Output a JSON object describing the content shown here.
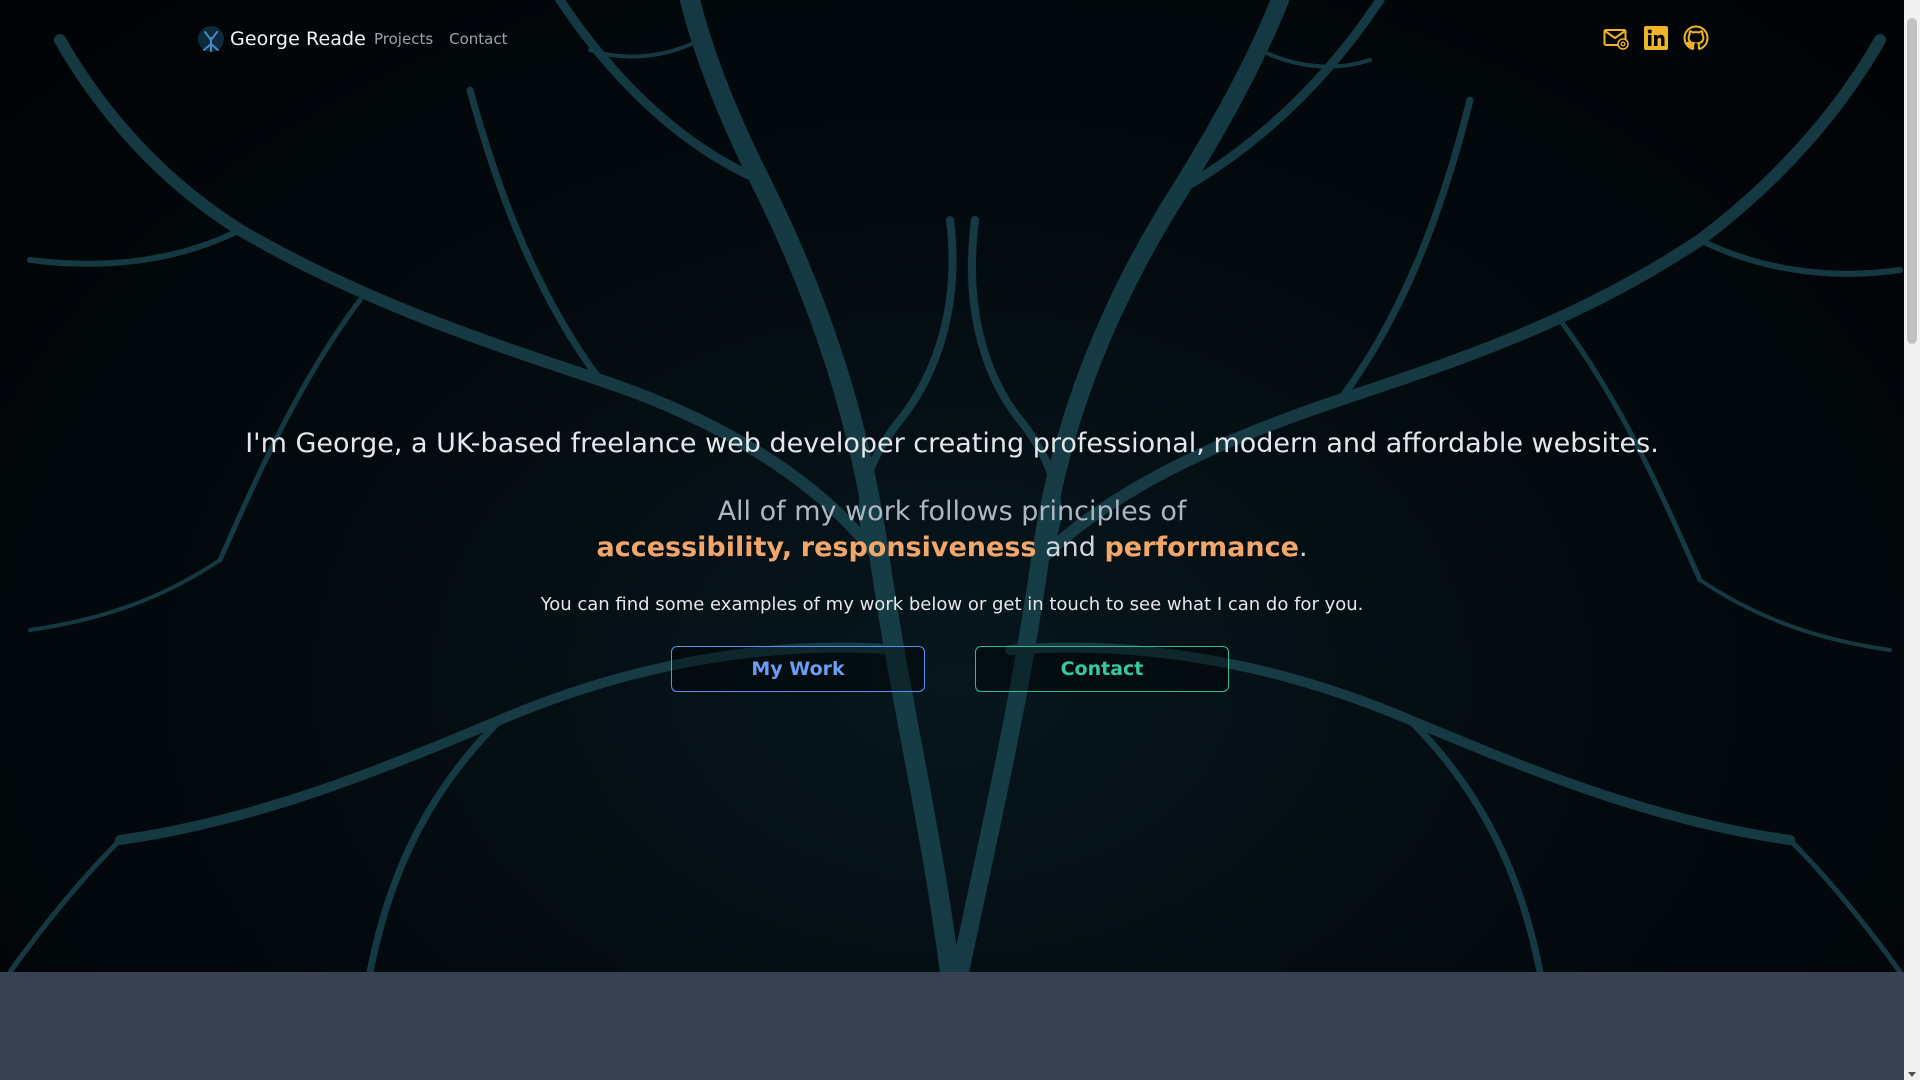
{
  "header": {
    "brand_name": "George Reade",
    "nav": [
      {
        "label": "Projects"
      },
      {
        "label": "Contact"
      }
    ],
    "social_icons": [
      "email-icon",
      "linkedin-icon",
      "github-icon"
    ]
  },
  "hero": {
    "intro": "I'm George, a UK-based freelance web developer creating professional, modern and affordable websites.",
    "principles": {
      "lead": "All of my work follows principles of",
      "accessibility": "accessibility,",
      "responsiveness": "responsiveness",
      "and": "and",
      "performance": "performance",
      "period": "."
    },
    "subtext": "You can find some examples of my work below or get in touch to see what I can do for you.",
    "buttons": {
      "work": "My Work",
      "contact": "Contact"
    }
  },
  "colors": {
    "accent_orange": "#f2a66a",
    "work_blue": "#5b8ff0",
    "contact_green": "#2fb995",
    "icon_yellow": "#f0b429",
    "section_bg": "#374151"
  }
}
